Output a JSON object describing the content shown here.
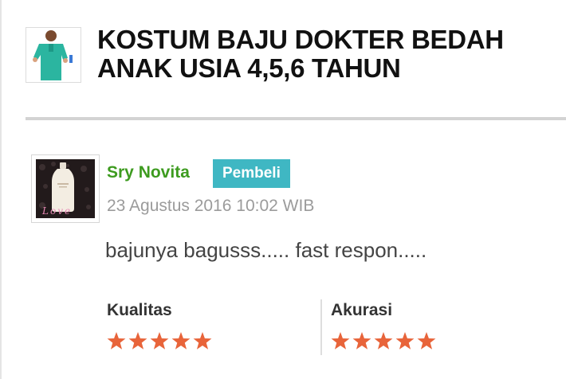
{
  "product": {
    "title": "KOSTUM BAJU DOKTER BEDAH ANAK USIA 4,5,6 TAHUN"
  },
  "review": {
    "reviewer_name": "Sry Novita",
    "badge": "Pembeli",
    "date": "23 Agustus 2016 10:02 WIB",
    "text": "bajunya bagusss..... fast respon.....",
    "avatar_text": "Love"
  },
  "ratings": [
    {
      "label": "Kualitas",
      "stars": 5,
      "max": 5
    },
    {
      "label": "Akurasi",
      "stars": 5,
      "max": 5
    }
  ],
  "colors": {
    "name": "#3d9b1f",
    "badge": "#3fb7c3",
    "star": "#e8643a",
    "scrub": "#2bb5a0"
  }
}
